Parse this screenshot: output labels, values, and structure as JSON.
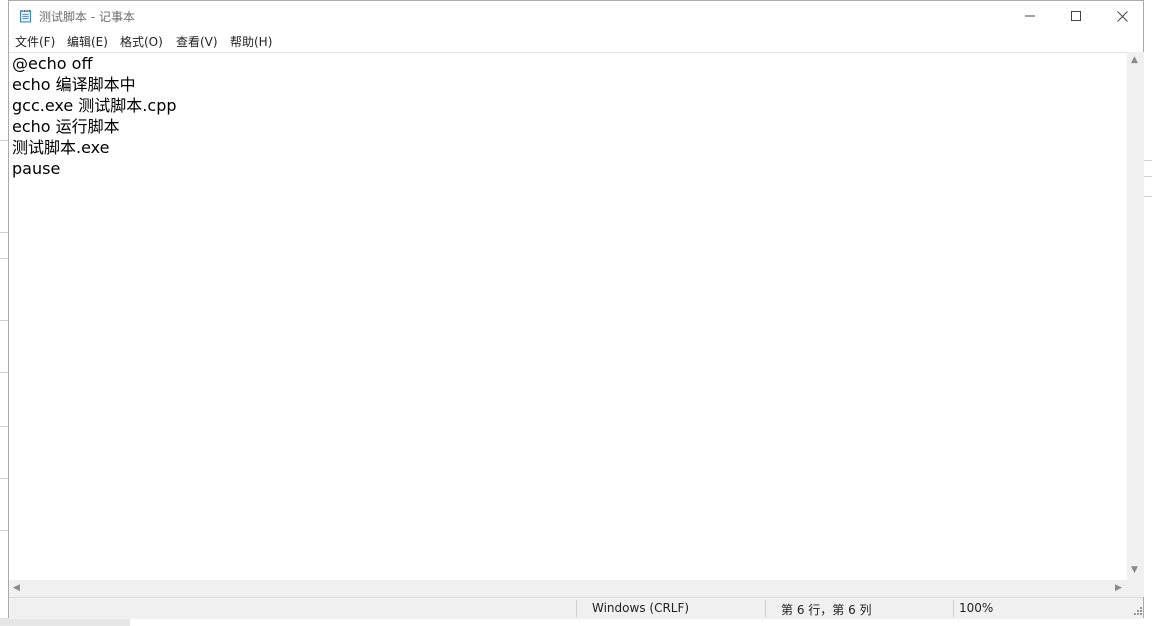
{
  "window": {
    "title": "测试脚本 - 记事本"
  },
  "menu": [
    {
      "label": "文件(F)"
    },
    {
      "label": "编辑(E)"
    },
    {
      "label": "格式(O)"
    },
    {
      "label": "查看(V)"
    },
    {
      "label": "帮助(H)"
    }
  ],
  "editor": {
    "lines": [
      "@echo off",
      "echo 编译脚本中",
      "gcc.exe 测试脚本.cpp",
      "echo 运行脚本",
      "测试脚本.exe",
      "pause"
    ]
  },
  "status": {
    "line_ending": "Windows (CRLF)",
    "position": "第 6 行，第 6 列",
    "zoom": "100%"
  },
  "icons": {
    "app": "notepad-icon",
    "minimize": "minimize-icon",
    "maximize": "maximize-icon",
    "close": "close-icon"
  }
}
